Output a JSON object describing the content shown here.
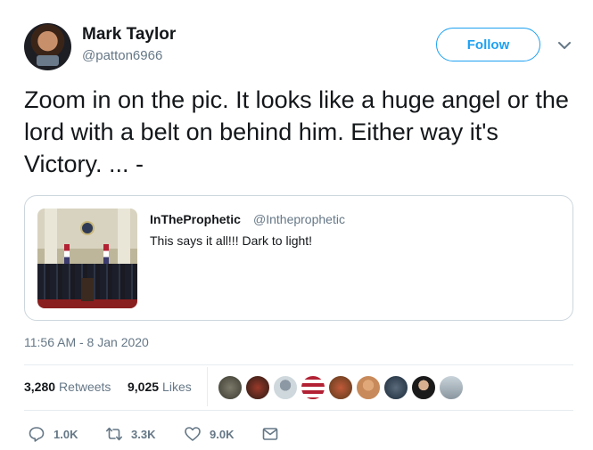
{
  "author": {
    "name": "Mark Taylor",
    "handle": "@patton6966"
  },
  "follow_label": "Follow",
  "tweet_text": "Zoom in on the pic. It looks like a huge angel or the lord with a belt on behind him. Either way it's Victory. ... -",
  "quoted": {
    "name": "InTheProphetic",
    "handle": "@Intheprophetic",
    "text": "This says it all!!! Dark to light!"
  },
  "timestamp": "11:56 AM - 8 Jan 2020",
  "stats": {
    "retweets_count": "3,280",
    "retweets_label": "Retweets",
    "likes_count": "9,025",
    "likes_label": "Likes"
  },
  "actions": {
    "reply_count": "1.0K",
    "retweet_count": "3.3K",
    "like_count": "9.0K"
  },
  "icons": [
    "chevron-down-icon",
    "reply-icon",
    "retweet-icon",
    "like-icon",
    "message-icon"
  ],
  "colors": {
    "accent": "#1da1f2",
    "muted": "#657786",
    "text": "#14171a",
    "border": "#ccd6dd"
  }
}
